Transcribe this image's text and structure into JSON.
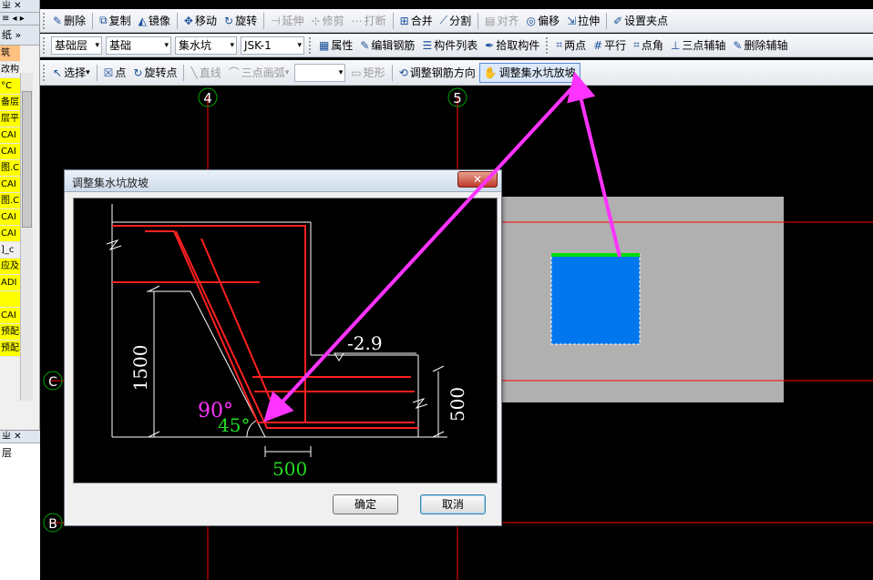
{
  "left_panel": {
    "header": "ㄓ ✕",
    "tabs": [
      "≡ ◂ ▸",
      "纸 »"
    ],
    "items": [
      {
        "label": "筑",
        "style": "o"
      },
      {
        "label": "改构",
        "style": ""
      },
      {
        "label": "°C",
        "style": "y"
      },
      {
        "label": "备层",
        "style": "y"
      },
      {
        "label": "层平",
        "style": "y"
      },
      {
        "label": "CAI",
        "style": "y"
      },
      {
        "label": "CAI",
        "style": "y"
      },
      {
        "label": "图.C",
        "style": "y"
      },
      {
        "label": "CAI",
        "style": "y"
      },
      {
        "label": "图.C",
        "style": "y"
      },
      {
        "label": "CAI",
        "style": "y"
      },
      {
        "label": "CAI",
        "style": "y"
      },
      {
        "label": "]_c",
        "style": ""
      },
      {
        "label": "应及",
        "style": "y"
      },
      {
        "label": "ADI",
        "style": "y"
      },
      {
        "label": "",
        "style": "y"
      },
      {
        "label": "CAI",
        "style": "y"
      },
      {
        "label": "预配",
        "style": "y"
      },
      {
        "label": "预配",
        "style": "y"
      }
    ],
    "lower_header": "ㄓ ✕",
    "lower_item": "层"
  },
  "toolbar1": [
    {
      "icon": "✎",
      "label": "删除",
      "dis": false
    },
    {
      "icon": "⧉",
      "label": "复制",
      "dis": false
    },
    {
      "icon": "◭",
      "label": "镜像",
      "dis": false
    },
    {
      "icon": "✥",
      "label": "移动",
      "dis": false
    },
    {
      "icon": "↻",
      "label": "旋转",
      "dis": false
    },
    {
      "icon": "⊣",
      "label": "延伸",
      "dis": true
    },
    {
      "icon": "⊹",
      "label": "修剪",
      "dis": true
    },
    {
      "icon": "⋯",
      "label": "打断",
      "dis": true
    },
    {
      "icon": "⊞",
      "label": "合并",
      "dis": false
    },
    {
      "icon": "⟋",
      "label": "分割",
      "dis": false
    },
    {
      "icon": "▤",
      "label": "对齐",
      "dis": true
    },
    {
      "icon": "◎",
      "label": "偏移",
      "dis": false
    },
    {
      "icon": "⇲",
      "label": "拉伸",
      "dis": false
    },
    {
      "icon": "✐",
      "label": "设置夹点",
      "dis": false
    }
  ],
  "toolbar2": {
    "floor": "基础层",
    "category": "基础",
    "type": "集水坑",
    "element": "JSK-1",
    "items": [
      {
        "icon": "▦",
        "label": "属性"
      },
      {
        "icon": "✎",
        "label": "编辑钢筋"
      },
      {
        "icon": "☰",
        "label": "构件列表"
      },
      {
        "icon": "✒",
        "label": "拾取构件"
      },
      {
        "icon": "⌗",
        "label": "两点"
      },
      {
        "icon": "#",
        "label": "平行"
      },
      {
        "icon": "⌗",
        "label": "点角"
      },
      {
        "icon": "⊥",
        "label": "三点辅轴"
      },
      {
        "icon": "✎",
        "label": "删除辅轴"
      }
    ]
  },
  "toolbar3": [
    {
      "icon": "↖",
      "label": "选择",
      "dis": false,
      "dd": true
    },
    {
      "icon": "☒",
      "label": "点",
      "dis": false
    },
    {
      "icon": "↻",
      "label": "旋转点",
      "dis": false
    },
    {
      "icon": "╲",
      "label": "直线",
      "dis": true
    },
    {
      "icon": "⌒",
      "label": "三点画弧",
      "dis": true,
      "dd": true
    },
    {
      "icon": "▭",
      "label": "矩形",
      "dis": true
    },
    {
      "icon": "⟲",
      "label": "调整钢筋方向",
      "dis": false
    },
    {
      "icon": "✋",
      "label": "调整集水坑放坡",
      "dis": false,
      "hl": true
    }
  ],
  "canvas": {
    "axes": [
      "4",
      "5",
      "C",
      "B"
    ]
  },
  "dialog": {
    "title": "调整集水坑放坡",
    "close": "✕",
    "ok": "确定",
    "cancel": "取消",
    "dims": {
      "h1500": "1500",
      "elev": "-2.9",
      "h500": "500",
      "w500": "500",
      "angle90": "90°",
      "angle45": "45°"
    }
  },
  "colors": {
    "arrow": "#ff33ff",
    "rebar": "#ff2020",
    "pit": "#0077ee",
    "pit_top": "#00dd00",
    "slab": "#b0b0b0",
    "axis": "#ff0000"
  }
}
